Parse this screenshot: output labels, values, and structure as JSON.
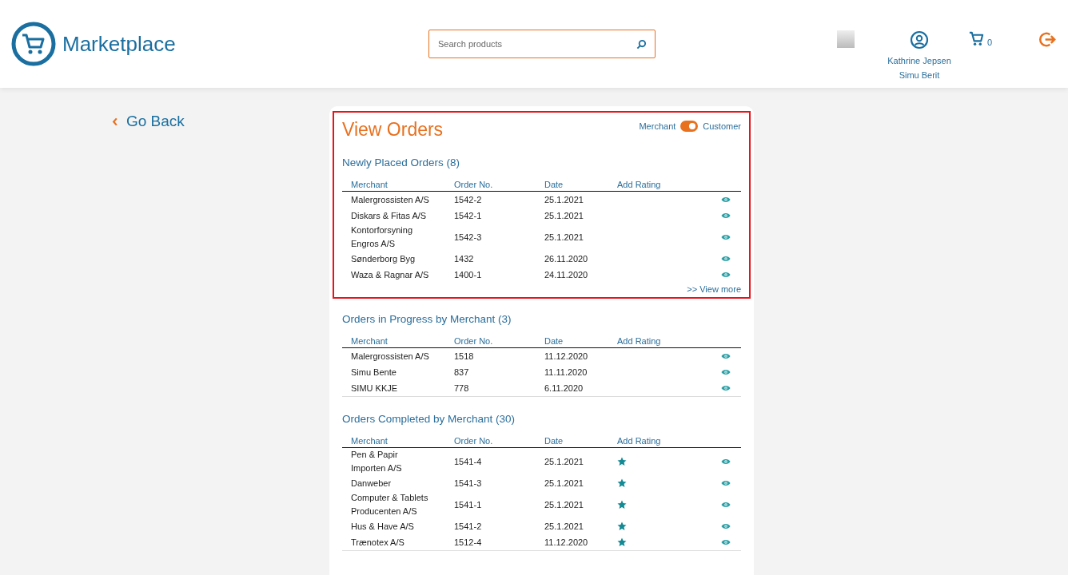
{
  "header": {
    "logo": "Marketplace",
    "search": {
      "placeholder": "Search products"
    },
    "user": {
      "name": "Kathrine Jepsen",
      "company": "Simu Berit"
    },
    "cart": {
      "count": "0"
    }
  },
  "back": {
    "label": "Go Back"
  },
  "card": {
    "title": "View Orders",
    "role_toggle": {
      "left_label": "Merchant",
      "right_label": "Customer",
      "on": true
    },
    "sections": [
      {
        "title": "Newly Placed Orders (8)",
        "highlighted": true,
        "columns": [
          "Merchant",
          "Order No.",
          "Date",
          "Add Rating"
        ],
        "view_more": ">> View more",
        "rows": [
          {
            "merchant": "Malergrossisten A/S",
            "order_no": "1542-2",
            "date": "25.1.2021",
            "can_rate": false
          },
          {
            "merchant": "Diskars & Fitas A/S",
            "order_no": "1542-1",
            "date": "25.1.2021",
            "can_rate": false
          },
          {
            "merchant": "Kontorforsyning\nEngros A/S",
            "order_no": "1542-3",
            "date": "25.1.2021",
            "can_rate": false
          },
          {
            "merchant": "Sønderborg Byg",
            "order_no": "1432",
            "date": "26.11.2020",
            "can_rate": false
          },
          {
            "merchant": "Waza & Ragnar A/S",
            "order_no": "1400-1",
            "date": "24.11.2020",
            "can_rate": false
          }
        ]
      },
      {
        "title": "Orders in Progress by Merchant (3)",
        "highlighted": false,
        "columns": [
          "Merchant",
          "Order No.",
          "Date",
          "Add Rating"
        ],
        "rows": [
          {
            "merchant": "Malergrossisten A/S",
            "order_no": "1518",
            "date": "11.12.2020",
            "can_rate": false
          },
          {
            "merchant": "Simu Bente",
            "order_no": "837",
            "date": "11.11.2020",
            "can_rate": false
          },
          {
            "merchant": "SIMU KKJE",
            "order_no": "778",
            "date": "6.11.2020",
            "can_rate": false
          }
        ]
      },
      {
        "title": "Orders Completed by Merchant (30)",
        "highlighted": false,
        "columns": [
          "Merchant",
          "Order No.",
          "Date",
          "Add Rating"
        ],
        "rows": [
          {
            "merchant": "Pen & Papir\nImporten A/S",
            "order_no": "1541-4",
            "date": "25.1.2021",
            "can_rate": true
          },
          {
            "merchant": "Danweber",
            "order_no": "1541-3",
            "date": "25.1.2021",
            "can_rate": true
          },
          {
            "merchant": "Computer & Tablets\nProducenten A/S",
            "order_no": "1541-1",
            "date": "25.1.2021",
            "can_rate": true
          },
          {
            "merchant": "Hus & Have A/S",
            "order_no": "1541-2",
            "date": "25.1.2021",
            "can_rate": true
          },
          {
            "merchant": "Trænotex A/S",
            "order_no": "1512-4",
            "date": "11.12.2020",
            "can_rate": true
          }
        ]
      }
    ]
  }
}
